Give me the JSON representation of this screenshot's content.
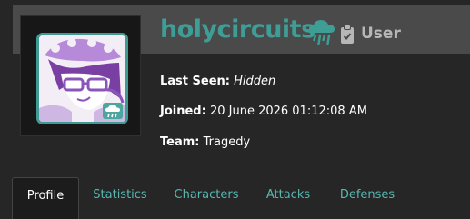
{
  "profile": {
    "username": "holycircuits",
    "role": "User",
    "weather_icon": "rain-cloud-icon",
    "role_icon": "clipboard-icon",
    "accent_color": "#3e9e96"
  },
  "info": {
    "last_seen_label": "Last Seen:",
    "last_seen_value": "Hidden",
    "joined_label": "Joined:",
    "joined_value": "20 June 2026 01:12:08 AM",
    "team_label": "Team:",
    "team_value": "Tragedy"
  },
  "tabs": [
    {
      "label": "Profile",
      "active": true
    },
    {
      "label": "Statistics",
      "active": false
    },
    {
      "label": "Characters",
      "active": false
    },
    {
      "label": "Attacks",
      "active": false
    },
    {
      "label": "Defenses",
      "active": false
    }
  ]
}
